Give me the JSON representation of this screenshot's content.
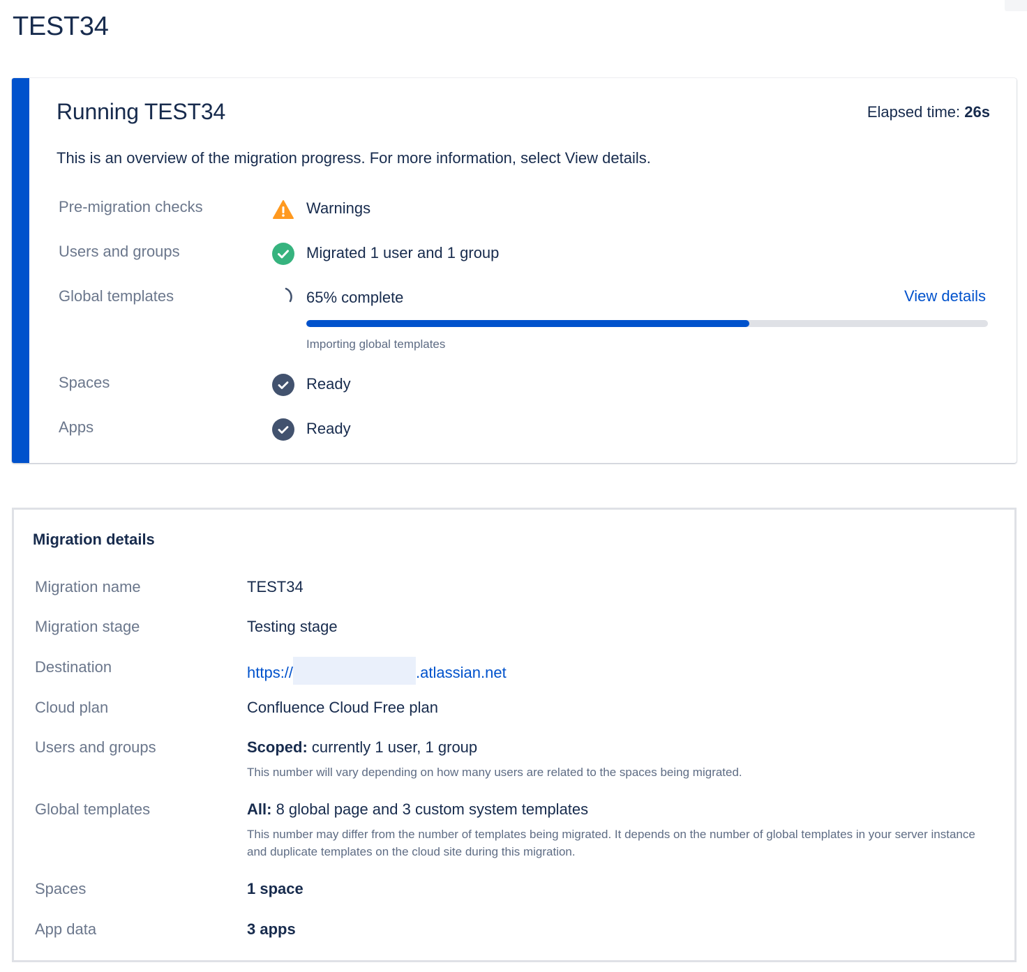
{
  "page": {
    "title": "TEST34"
  },
  "progress": {
    "title": "Running TEST34",
    "elapsed_label": "Elapsed time:",
    "elapsed_value": "26s",
    "description": "This is an overview of the migration progress. For more information, select View details.",
    "rows": [
      {
        "label": "Pre-migration checks",
        "status": "Warnings",
        "icon": "warning-icon",
        "color": "#ff991f"
      },
      {
        "label": "Users and groups",
        "status": "Migrated 1 user and 1 group",
        "icon": "check-circle-icon",
        "color": "#36b37e"
      },
      {
        "label": "Global templates",
        "status": "65% complete",
        "icon": "spinner-icon",
        "color": "#42526e"
      },
      {
        "label": "Spaces",
        "status": "Ready",
        "icon": "check-circle-icon",
        "color": "#42526e"
      },
      {
        "label": "Apps",
        "status": "Ready",
        "icon": "check-circle-icon",
        "color": "#42526e"
      }
    ],
    "view_details_label": "View details",
    "progress_percent": 65,
    "progress_caption": "Importing global templates",
    "accent_color": "#0052cc"
  },
  "details": {
    "title": "Migration details",
    "migration_name": {
      "label": "Migration name",
      "value": "TEST34"
    },
    "migration_stage": {
      "label": "Migration stage",
      "value": "Testing stage"
    },
    "destination": {
      "label": "Destination",
      "prefix": "https://",
      "suffix": ".atlassian.net"
    },
    "cloud_plan": {
      "label": "Cloud plan",
      "value": "Confluence Cloud Free plan"
    },
    "users_groups": {
      "label": "Users and groups",
      "bold": "Scoped:",
      "value": " currently 1 user, 1 group",
      "note": "This number will vary depending on how many users are related to the spaces being migrated."
    },
    "global_templates": {
      "label": "Global templates",
      "bold": "All:",
      "value": " 8 global page and 3 custom system templates",
      "note": "This number may differ from the number of templates being migrated. It depends on the number of global templates in your server instance and duplicate templates on the cloud site during this migration."
    },
    "spaces": {
      "label": "Spaces",
      "value": "1 space"
    },
    "app_data": {
      "label": "App data",
      "value": "3 apps"
    }
  }
}
